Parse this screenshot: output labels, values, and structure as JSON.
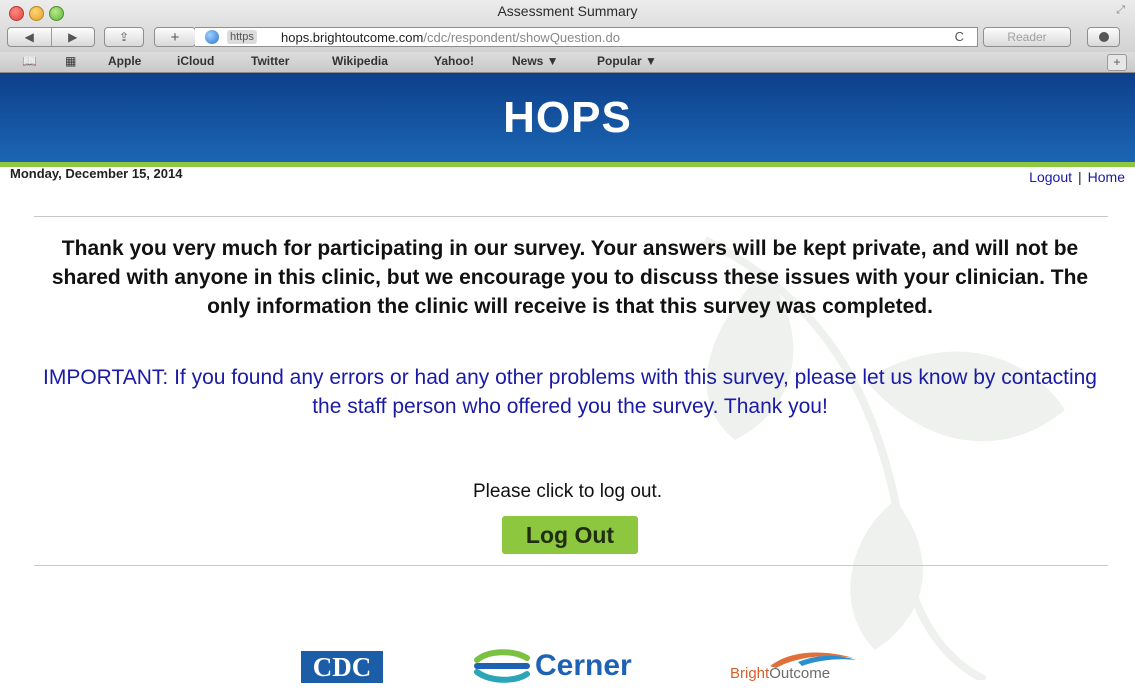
{
  "browser": {
    "window_title": "Assessment Summary",
    "address": {
      "scheme_badge": "https",
      "domain": "hops.brightoutcome.com",
      "path": "/cdc/respondent/showQuestion.do"
    },
    "reader_label": "Reader",
    "nav_buttons": {
      "back": "◀",
      "forward": "▶",
      "share": "⇪",
      "add": "+",
      "reload": "C"
    },
    "bookmarks": [
      "Apple",
      "iCloud",
      "Twitter",
      "Wikipedia",
      "Yahoo!",
      "News ▼",
      "Popular ▼"
    ],
    "bookmark_icons": {
      "reading_list": "📖",
      "top_sites": "▦"
    },
    "bookmark_add": "+"
  },
  "page": {
    "brand": "HOPS",
    "date": "Monday, December 15, 2014",
    "links": {
      "logout": "Logout",
      "separator": "|",
      "home": "Home"
    },
    "thanks_text": "Thank you very much for participating in our survey. Your answers will be kept private, and will not be shared with anyone in this clinic, but we encourage you to discuss these issues with your clinician. The only information the clinic will receive is that this survey was completed.",
    "important_text": "IMPORTANT: If you found any errors or had any other problems with this survey, please let us know by contacting the staff person who offered you the survey. Thank you!",
    "click_prompt": "Please click to log out.",
    "logout_button": "Log Out"
  },
  "footer_logos": {
    "cdc": "CDC",
    "cerner": "Cerner",
    "brightoutcome_a": "Bright",
    "brightoutcome_b": "Outcome"
  },
  "colors": {
    "banner": "#1b66b4",
    "accent_green": "#8dc63f",
    "link_blue": "#1a1aa6"
  }
}
